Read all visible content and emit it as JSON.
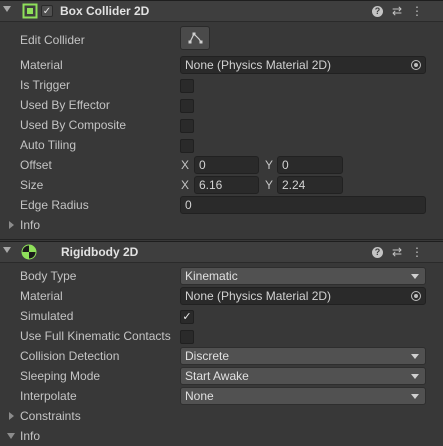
{
  "box_collider": {
    "title": "Box Collider 2D",
    "enabled": true,
    "edit_collider_label": "Edit Collider",
    "material_label": "Material",
    "material_value": "None (Physics Material 2D)",
    "is_trigger_label": "Is Trigger",
    "is_trigger": false,
    "used_by_effector_label": "Used By Effector",
    "used_by_effector": false,
    "used_by_composite_label": "Used By Composite",
    "used_by_composite": false,
    "auto_tiling_label": "Auto Tiling",
    "auto_tiling": false,
    "offset_label": "Offset",
    "offset_x_label": "X",
    "offset_x": "0",
    "offset_y_label": "Y",
    "offset_y": "0",
    "size_label": "Size",
    "size_x_label": "X",
    "size_x": "6.16",
    "size_y_label": "Y",
    "size_y": "2.24",
    "edge_radius_label": "Edge Radius",
    "edge_radius": "0",
    "info_label": "Info",
    "icon_color": "#8fe05a"
  },
  "rigidbody": {
    "title": "Rigidbody 2D",
    "body_type_label": "Body Type",
    "body_type": "Kinematic",
    "material_label": "Material",
    "material_value": "None (Physics Material 2D)",
    "simulated_label": "Simulated",
    "simulated": true,
    "use_full_kinematic_label": "Use Full Kinematic Contacts",
    "use_full_kinematic": false,
    "collision_detection_label": "Collision Detection",
    "collision_detection": "Discrete",
    "sleeping_mode_label": "Sleeping Mode",
    "sleeping_mode": "Start Awake",
    "interpolate_label": "Interpolate",
    "interpolate": "None",
    "constraints_label": "Constraints",
    "info_label": "Info",
    "icon_color": "#8fe05a"
  },
  "header_icons": {
    "help": "?",
    "presets": "⇄",
    "menu": "⋮",
    "checkmark": "✓"
  }
}
